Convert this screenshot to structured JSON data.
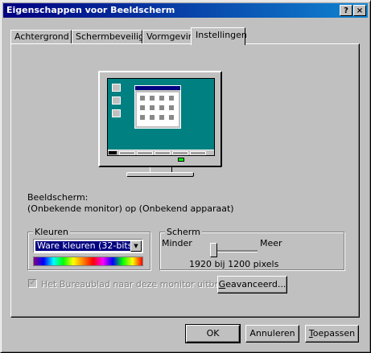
{
  "window": {
    "title": "Eigenschappen voor Beeldscherm",
    "help_glyph": "?",
    "close_glyph": "×"
  },
  "tabs": [
    {
      "label": "Achtergrond"
    },
    {
      "label": "Schermbeveiliging"
    },
    {
      "label": "Vormgeving"
    },
    {
      "label": "Instellingen",
      "active": true
    }
  ],
  "display": {
    "label": "Beeldscherm:",
    "value": "(Onbekende monitor) op (Onbekend apparaat)"
  },
  "colors_group": {
    "legend": "Kleuren",
    "selected": "Ware kleuren (32-bits)",
    "arrow_glyph": "▼"
  },
  "screen_group": {
    "legend": "Scherm",
    "min_label": "Minder",
    "max_label": "Meer",
    "resolution": "1920 bij 1200 pixels",
    "slider_level": 0
  },
  "extend_checkbox": {
    "label": "Het Bureaublad naar deze monitor uitbreiden.",
    "checked": true,
    "glyph": "✓"
  },
  "buttons": {
    "advanced": {
      "prefix": "",
      "accel": "G",
      "rest": "eavanceerd..."
    },
    "ok": "OK",
    "cancel": "Annuleren",
    "apply": {
      "accel": "T",
      "rest": "oepassen"
    }
  }
}
